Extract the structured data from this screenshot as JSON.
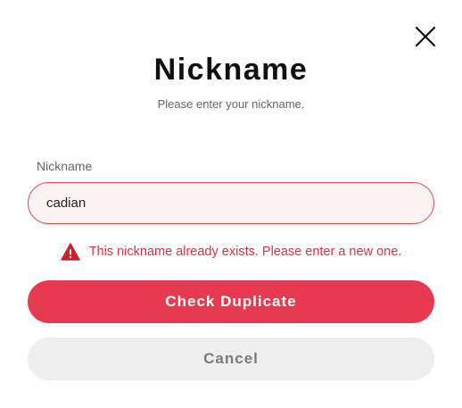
{
  "dialog": {
    "title": "Nickname",
    "subtitle": "Please enter your nickname.",
    "close_icon": "close-icon"
  },
  "form": {
    "field_label": "Nickname",
    "nickname_value": "cadian",
    "error_icon": "warning-triangle-icon",
    "error_message": "This nickname already exists. Please enter a new one."
  },
  "buttons": {
    "check_duplicate": "Check Duplicate",
    "cancel": "Cancel"
  },
  "colors": {
    "accent": "#e63a50",
    "error": "#d9334a",
    "input_background": "#fbf3f3",
    "secondary_button": "#eeeeee"
  }
}
